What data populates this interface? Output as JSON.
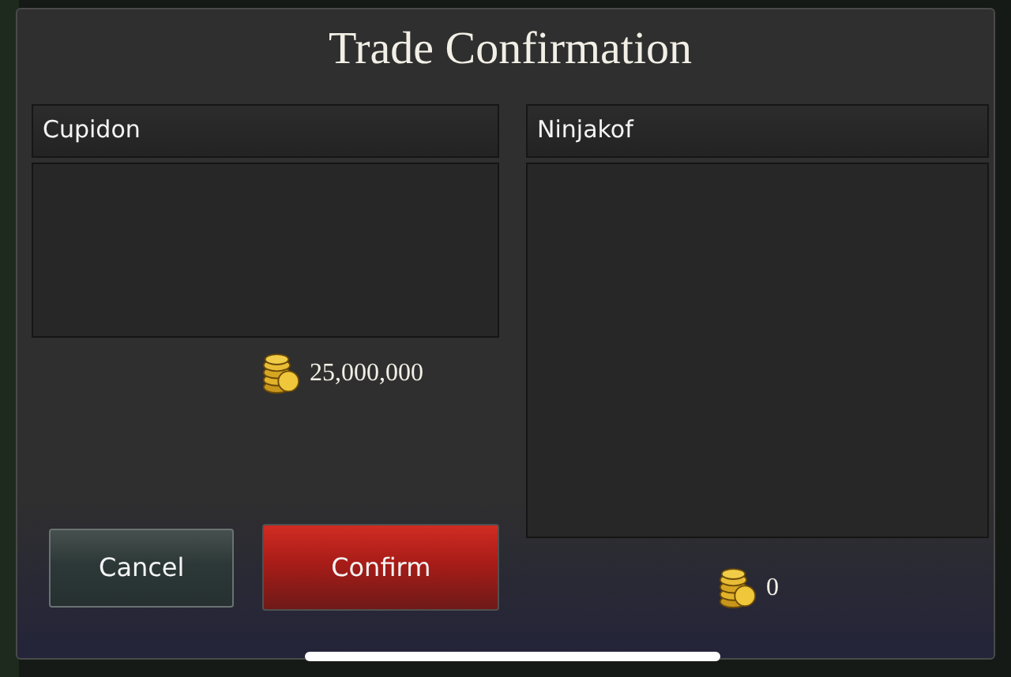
{
  "dialog": {
    "title": "Trade Confirmation"
  },
  "parties": [
    {
      "name": "Cupidon",
      "gold": "25,000,000"
    },
    {
      "name": "Ninjakof",
      "gold": "0"
    }
  ],
  "buttons": [
    {
      "label": "Cancel",
      "kind": "secondary"
    },
    {
      "label": "Confirm",
      "kind": "primary"
    }
  ]
}
